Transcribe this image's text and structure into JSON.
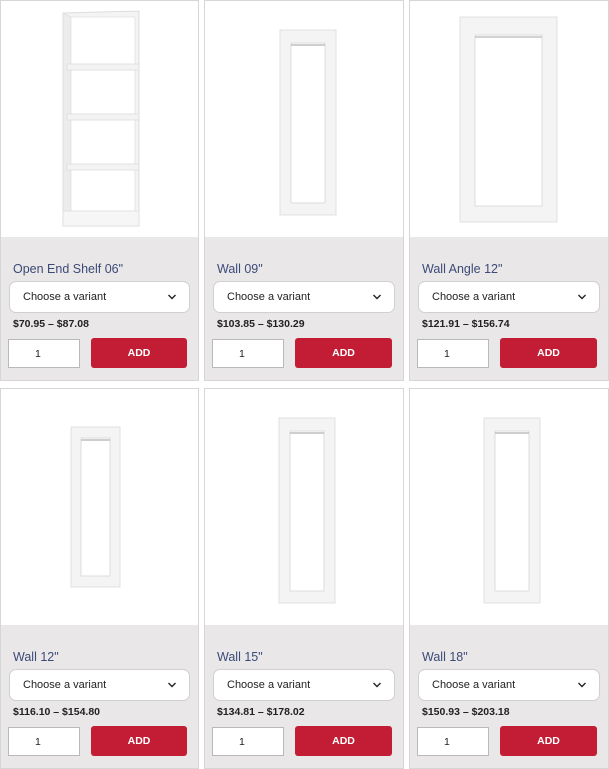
{
  "products": [
    {
      "name": "Open End Shelf 06\"",
      "variant_placeholder": "Choose a variant",
      "price": "$70.95 – $87.08",
      "quantity": "1",
      "add_label": "ADD",
      "image": "open-shelf"
    },
    {
      "name": "Wall 09\"",
      "variant_placeholder": "Choose a variant",
      "price": "$103.85 – $130.29",
      "quantity": "1",
      "add_label": "ADD",
      "image": "narrow-door"
    },
    {
      "name": "Wall Angle 12\"",
      "variant_placeholder": "Choose a variant",
      "price": "$121.91 – $156.74",
      "quantity": "1",
      "add_label": "ADD",
      "image": "wide-door"
    },
    {
      "name": "Wall 12\"",
      "variant_placeholder": "Choose a variant",
      "price": "$116.10 – $154.80",
      "quantity": "1",
      "add_label": "ADD",
      "image": "narrow-door"
    },
    {
      "name": "Wall 15\"",
      "variant_placeholder": "Choose a variant",
      "price": "$134.81 – $178.02",
      "quantity": "1",
      "add_label": "ADD",
      "image": "narrow-door"
    },
    {
      "name": "Wall 18\"",
      "variant_placeholder": "Choose a variant",
      "price": "$150.93 – $203.18",
      "quantity": "1",
      "add_label": "ADD",
      "image": "narrow-door"
    }
  ],
  "colors": {
    "add_button": "#c21d34",
    "title_text": "#3b4a78",
    "card_background": "#e9e7e7"
  }
}
